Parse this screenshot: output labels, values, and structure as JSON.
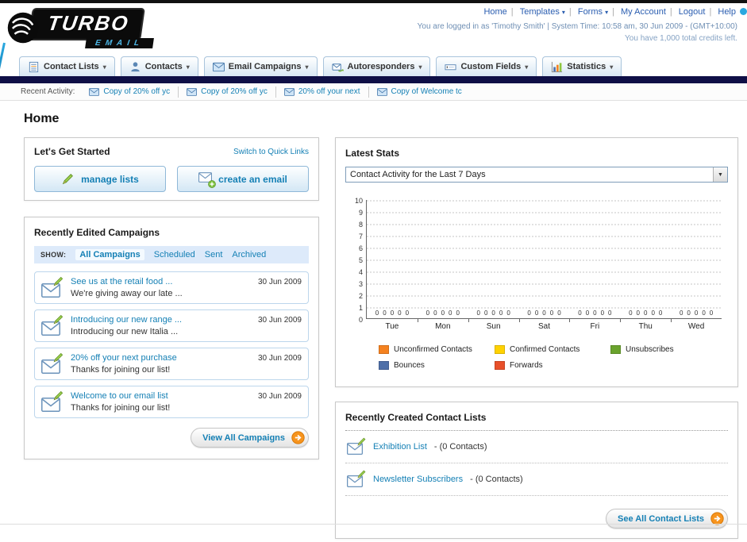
{
  "header": {
    "logo_primary": "TURBO",
    "logo_secondary": "EMAIL",
    "links": [
      {
        "label": "Home",
        "dropdown": false
      },
      {
        "label": "Templates",
        "dropdown": true
      },
      {
        "label": "Forms",
        "dropdown": true
      },
      {
        "label": "My Account",
        "dropdown": false
      },
      {
        "label": "Logout",
        "dropdown": false
      },
      {
        "label": "Help",
        "dropdown": false
      }
    ],
    "session_line": "You are logged in as 'Timothy Smith' | System Time: 10:58 am, 30 Jun 2009 - (GMT+10:00)",
    "credits_line": "You have 1,000 total credits left."
  },
  "nav": {
    "tabs": [
      {
        "label": "Contact Lists"
      },
      {
        "label": "Contacts"
      },
      {
        "label": "Email Campaigns"
      },
      {
        "label": "Autoresponders"
      },
      {
        "label": "Custom Fields"
      },
      {
        "label": "Statistics"
      }
    ]
  },
  "recent_activity": {
    "label": "Recent Activity:",
    "items": [
      {
        "text": "Copy of 20% off yc"
      },
      {
        "text": "Copy of 20% off yc"
      },
      {
        "text": "20% off your next"
      },
      {
        "text": "Copy of Welcome tc"
      }
    ]
  },
  "page": {
    "title": "Home"
  },
  "get_started": {
    "title": "Let's Get Started",
    "switch_link": "Switch to Quick Links",
    "manage_lists_button": "manage lists",
    "create_email_button": "create an email"
  },
  "campaigns": {
    "title": "Recently Edited Campaigns",
    "show_label": "SHOW:",
    "filters": [
      {
        "label": "All Campaigns",
        "active": true
      },
      {
        "label": "Scheduled",
        "active": false
      },
      {
        "label": "Sent",
        "active": false
      },
      {
        "label": "Archived",
        "active": false
      }
    ],
    "rows": [
      {
        "title": "See us at the retail food ...",
        "subtitle": "We're giving away our late ...",
        "date": "30 Jun 2009"
      },
      {
        "title": "Introducing our new range ...",
        "subtitle": "Introducing our new Italia ...",
        "date": "30 Jun 2009"
      },
      {
        "title": "20% off your next purchase",
        "subtitle": "Thanks for joining our list!",
        "date": "30 Jun 2009"
      },
      {
        "title": "Welcome to our email list",
        "subtitle": "Thanks for joining our list!",
        "date": "30 Jun 2009"
      }
    ],
    "view_all_button": "View All Campaigns"
  },
  "stats": {
    "title": "Latest Stats",
    "selected_option": "Contact Activity for the Last 7 Days",
    "chart_data": {
      "type": "bar",
      "title": "Contact Activity for the Last 7 Days",
      "categories": [
        "Tue",
        "Mon",
        "Sun",
        "Sat",
        "Fri",
        "Thu",
        "Wed"
      ],
      "series": [
        {
          "name": "Unconfirmed Contacts",
          "color": "#f58220",
          "values": [
            0,
            0,
            0,
            0,
            0,
            0,
            0
          ]
        },
        {
          "name": "Confirmed Contacts",
          "color": "#ffd200",
          "values": [
            0,
            0,
            0,
            0,
            0,
            0,
            0
          ]
        },
        {
          "name": "Unsubscribes",
          "color": "#6aa32d",
          "values": [
            0,
            0,
            0,
            0,
            0,
            0,
            0
          ]
        },
        {
          "name": "Bounces",
          "color": "#4f6fa8",
          "values": [
            0,
            0,
            0,
            0,
            0,
            0,
            0
          ]
        },
        {
          "name": "Forwards",
          "color": "#e8502a",
          "values": [
            0,
            0,
            0,
            0,
            0,
            0,
            0
          ]
        }
      ],
      "ylim": [
        0,
        10
      ],
      "y_tick_step": 1,
      "grid": "dotted-horizontal",
      "value_labels_shown": true,
      "legend_position": "bottom"
    }
  },
  "contact_lists": {
    "title": "Recently Created Contact Lists",
    "items": [
      {
        "name": "Exhibition List",
        "suffix": "- (0 Contacts)"
      },
      {
        "name": "Newsletter Subscribers",
        "suffix": "- (0 Contacts)"
      }
    ],
    "see_all_button": "See All Contact Lists"
  }
}
